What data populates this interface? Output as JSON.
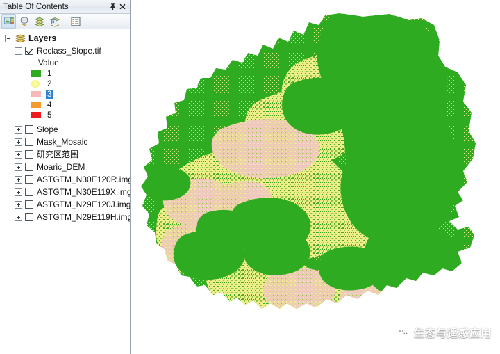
{
  "window": {
    "panel_title": "Table Of Contents",
    "pin_icon": "pushpin-icon",
    "close_icon": "close-icon"
  },
  "toolbar": {
    "buttons": [
      {
        "name": "list-by-drawing-order",
        "icon": "list-by-drawing-order-icon",
        "active": true
      },
      {
        "name": "list-by-source",
        "icon": "list-by-source-icon",
        "active": false
      },
      {
        "name": "list-by-visibility",
        "icon": "list-by-visibility-icon",
        "active": false
      },
      {
        "name": "list-by-selection",
        "icon": "list-by-selection-icon",
        "active": false
      },
      {
        "name": "options",
        "icon": "options-icon",
        "active": false
      }
    ]
  },
  "toc": {
    "root": {
      "label": "Layers",
      "expanded": true,
      "icon": "layers-icon"
    },
    "active_layer": {
      "label": "Reclass_Slope.tif",
      "checked": true,
      "expanded": true,
      "field_header": "Value",
      "symbology": [
        {
          "label": "1",
          "color": "#2eab20",
          "shape": "square",
          "selected": false
        },
        {
          "label": "2",
          "color": "#f7f77a",
          "shape": "circle",
          "selected": false
        },
        {
          "label": "3",
          "color": "#f5b9b9",
          "shape": "square",
          "selected": true
        },
        {
          "label": "4",
          "color": "#f59b2b",
          "shape": "square",
          "selected": false
        },
        {
          "label": "5",
          "color": "#ee1c1c",
          "shape": "square",
          "selected": false
        }
      ]
    },
    "layers": [
      {
        "label": "Slope",
        "checked": false,
        "expanded": false
      },
      {
        "label": "Mask_Mosaic",
        "checked": false,
        "expanded": false
      },
      {
        "label": "研究区范围",
        "checked": false,
        "expanded": false
      },
      {
        "label": "Moaric_DEM",
        "checked": false,
        "expanded": false
      },
      {
        "label": "ASTGTM_N30E120R.img",
        "checked": false,
        "expanded": false
      },
      {
        "label": "ASTGTM_N30E119X.img",
        "checked": false,
        "expanded": false
      },
      {
        "label": "ASTGTM_N29E120J.img",
        "checked": false,
        "expanded": false
      },
      {
        "label": "ASTGTM_N29E119H.img",
        "checked": false,
        "expanded": false
      }
    ]
  },
  "map": {
    "background": "#ffffff",
    "class_colors": {
      "class1_green": "#2eab20",
      "class2_yellow": "#eeee8a",
      "class3_pink": "#eec9bb",
      "class4_orange": "#f59b2b",
      "class5_red": "#ee1c1c"
    }
  },
  "watermark": {
    "text": "生态与遥感应用",
    "icon": "wechat-icon"
  }
}
